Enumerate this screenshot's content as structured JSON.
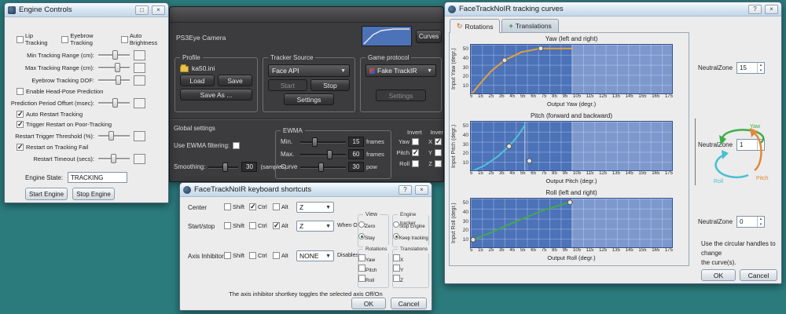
{
  "desktop": {
    "background": "#2b7b7d"
  },
  "engine": {
    "title": "Engine Controls",
    "checks_top": [
      {
        "label": "Lip Tracking",
        "checked": false
      },
      {
        "label": "Eyebrow Tracking",
        "checked": false
      },
      {
        "label": "Auto Brightness",
        "checked": false
      }
    ],
    "rows": [
      {
        "label": "Min Tracking Range (cm):"
      },
      {
        "label": "Max Tracking Range (cm):"
      },
      {
        "label": "Eyebrow Tracking DOF:"
      },
      {
        "label": "Enable Head-Pose Prediction",
        "checked": false
      },
      {
        "label": "Prediction Period Offset (msec):"
      },
      {
        "label": "Auto Restart Tracking",
        "checked": true
      },
      {
        "label": "Trigger Restart on Poor-Tracking",
        "checked": true
      },
      {
        "label": "Restart Trigger Threshold (%):"
      },
      {
        "label": "Restart on Tracking Fail",
        "checked": true
      },
      {
        "label": "Restart Timeout (secs):"
      }
    ],
    "state_label": "Engine State:",
    "state_value": "TRACKING",
    "start_button": "Start Engine",
    "stop_button": "Stop Engine"
  },
  "main": {
    "camera_label": "PS3Eye Camera",
    "curves_button": "Curves",
    "profile": {
      "title": "Profile",
      "file": "ka50.ini",
      "load": "Load",
      "save": "Save",
      "save_as": "Save As ..."
    },
    "tracker": {
      "title": "Tracker Source",
      "selected": "Face API",
      "start": "Start",
      "stop": "Stop",
      "settings": "Settings"
    },
    "protocol": {
      "title": "Game protocol",
      "selected": "Fake TrackIR",
      "settings": "Settings"
    },
    "filters": {
      "global_label": "Global settings",
      "ewma_check": {
        "label": "Use EWMA filtering:",
        "checked": false
      },
      "smoothing_label": "Smoothing:",
      "smoothing_value": "30",
      "smoothing_unit": "(samples)",
      "ewma_group": {
        "title": "EWMA",
        "rows": [
          {
            "label": "Min.",
            "value": "15",
            "unit": "frames"
          },
          {
            "label": "Max.",
            "value": "60",
            "unit": "frames"
          },
          {
            "label": "Curve",
            "value": "30",
            "unit": "pow"
          }
        ]
      },
      "invert": {
        "header": "Invert",
        "rows": [
          {
            "rot": "Yaw",
            "rot_checked": false,
            "trans": "X",
            "trans_checked": true
          },
          {
            "rot": "Pitch",
            "rot_checked": true,
            "trans": "Y",
            "trans_checked": false
          },
          {
            "rot": "Roll",
            "rot_checked": false,
            "trans": "Z",
            "trans_checked": false
          }
        ]
      }
    }
  },
  "shortcuts": {
    "title": "FaceTrackNoIR keyboard shortcuts",
    "mod_labels": [
      "Shift",
      "Ctrl",
      "Alt"
    ],
    "rows": [
      {
        "label": "Center",
        "mods": [
          false,
          true,
          false
        ],
        "key": "Z"
      },
      {
        "label": "Start/stop",
        "mods": [
          false,
          false,
          true
        ],
        "key": "Z"
      },
      {
        "label": "Axis Inhibitor",
        "mods": [
          false,
          false,
          false
        ],
        "key": "NONE"
      }
    ],
    "when_off": "When OFF:",
    "disables_label": "Disables:",
    "view": {
      "title": "View",
      "options": [
        {
          "label": "Zero",
          "on": false
        },
        {
          "label": "Stay",
          "on": true
        }
      ]
    },
    "engine_tracker": {
      "title": "Engine tracker",
      "options": [
        {
          "label": "Stop Engine",
          "on": false
        },
        {
          "label": "Keep tracking",
          "on": true
        }
      ]
    },
    "rotations": {
      "title": "Rotations",
      "options": [
        {
          "label": "Yaw",
          "on": false
        },
        {
          "label": "Pitch",
          "on": false
        },
        {
          "label": "Roll",
          "on": false
        }
      ]
    },
    "translations": {
      "title": "Translations",
      "options": [
        {
          "label": "X",
          "on": false
        },
        {
          "label": "Y",
          "on": false
        },
        {
          "label": "Z",
          "on": false
        }
      ]
    },
    "note": "The axis inhibitor shortkey toggles the selected axis Off/On",
    "ok": "OK",
    "cancel": "Cancel"
  },
  "curves_win": {
    "title": "FaceTrackNoIR tracking curves",
    "tabs": [
      {
        "label": "Rotations"
      },
      {
        "label": "Translations"
      }
    ],
    "neutral_label": "NeutralZone",
    "hint1": "Use the circular handles to change",
    "hint2": "the curve(s).",
    "gizmo_labels": {
      "yaw": "Yaw",
      "pitch": "Pitch",
      "roll": "Roll"
    },
    "ok": "OK",
    "cancel": "Cancel"
  },
  "chart_data": [
    {
      "type": "line",
      "title": "Yaw (left and right)",
      "xlabel": "Output Yaw (degr.)",
      "ylabel": "Input Yaw (degr.)",
      "xticks": [
        "5",
        "15",
        "25",
        "35",
        "45",
        "55",
        "65",
        "75",
        "85",
        "95",
        "105",
        "115",
        "125",
        "135",
        "145",
        "155",
        "165",
        "175"
      ],
      "yticks": [
        "50",
        "40",
        "30",
        "20",
        "10"
      ],
      "xmax": 180,
      "ymax": 55,
      "color": "#e2a13c",
      "points": [
        [
          0,
          0
        ],
        [
          8,
          12
        ],
        [
          18,
          26
        ],
        [
          30,
          38
        ],
        [
          45,
          47
        ],
        [
          62,
          51
        ],
        [
          90,
          51
        ]
      ],
      "handles": [
        [
          30,
          38
        ],
        [
          62,
          51
        ]
      ],
      "neutral_zone": "15"
    },
    {
      "type": "line",
      "title": "Pitch (forward and backward)",
      "xlabel": "Output Pitch (degr.)",
      "ylabel": "Input Pitch (degr.)",
      "xticks": [
        "5",
        "15",
        "25",
        "35",
        "45",
        "55",
        "65",
        "75",
        "85",
        "95",
        "105",
        "115",
        "125",
        "135",
        "145",
        "155",
        "165",
        "175"
      ],
      "yticks": [
        "50",
        "40",
        "30",
        "20",
        "10"
      ],
      "xmax": 180,
      "ymax": 55,
      "color": "#4fc3d8",
      "points": [
        [
          0,
          0
        ],
        [
          12,
          7
        ],
        [
          24,
          17
        ],
        [
          34,
          28
        ],
        [
          42,
          40
        ],
        [
          48,
          51
        ]
      ],
      "handles": [
        [
          34,
          28
        ],
        [
          52,
          12
        ]
      ],
      "vline_x": 48,
      "neutral_zone": "1"
    },
    {
      "type": "line",
      "title": "Roll (left and right)",
      "xlabel": "Output Roll (degr.)",
      "ylabel": "Input Roll (degr.)",
      "xticks": [
        "5",
        "15",
        "25",
        "35",
        "45",
        "55",
        "65",
        "75",
        "85",
        "95",
        "105",
        "115",
        "125",
        "135",
        "145",
        "155",
        "165",
        "175"
      ],
      "yticks": [
        "50",
        "40",
        "30",
        "20",
        "10"
      ],
      "xmax": 180,
      "ymax": 55,
      "color": "#43a94d",
      "points": [
        [
          0,
          9
        ],
        [
          20,
          19
        ],
        [
          42,
          31
        ],
        [
          66,
          43
        ],
        [
          88,
          51
        ]
      ],
      "handles": [
        [
          2,
          10
        ],
        [
          88,
          51
        ]
      ],
      "neutral_zone": "0"
    }
  ]
}
